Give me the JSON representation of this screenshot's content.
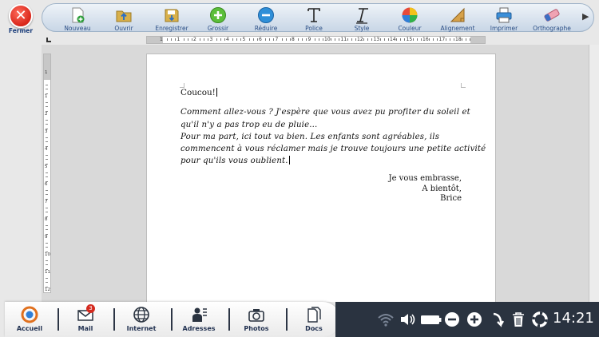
{
  "window": {
    "close_label": "Fermer",
    "close_glyph": "✕"
  },
  "toolbar": {
    "items": [
      {
        "label": "Nouveau",
        "icon": "new-document-icon"
      },
      {
        "label": "Ouvrir",
        "icon": "open-folder-icon"
      },
      {
        "label": "Enregistrer",
        "icon": "save-icon"
      },
      {
        "label": "Grossir",
        "icon": "zoom-in-icon"
      },
      {
        "label": "Réduire",
        "icon": "zoom-out-icon"
      },
      {
        "label": "Police",
        "icon": "font-icon"
      },
      {
        "label": "Style",
        "icon": "style-icon"
      },
      {
        "label": "Couleur",
        "icon": "color-icon"
      },
      {
        "label": "Alignement",
        "icon": "alignment-icon"
      },
      {
        "label": "Imprimer",
        "icon": "print-icon"
      },
      {
        "label": "Orthographe",
        "icon": "spellcheck-icon"
      }
    ],
    "more_glyph": "▶"
  },
  "ruler": {
    "h_numbers": [
      "1",
      "1",
      "2",
      "3",
      "4",
      "5",
      "6",
      "7",
      "8",
      "9",
      "10",
      "11",
      "12",
      "13",
      "14",
      "15",
      "16",
      "17",
      "18"
    ],
    "v_numbers": [
      "1",
      "1",
      "2",
      "3",
      "4",
      "5",
      "6",
      "7",
      "8",
      "9",
      "10",
      "11",
      "12"
    ]
  },
  "document": {
    "title": "Coucou!",
    "body_lines": [
      "Comment allez-vous ? J'espère que vous avez pu profiter du soleil et",
      "qu'il n'y a pas trop eu de pluie...",
      "Pour ma part, ici tout va bien. Les enfants sont agréables, ils",
      "commencent à vous réclamer mais je trouve toujours une petite activité",
      "pour qu'ils vous oublient."
    ],
    "signature_lines": [
      "Je vous embrasse,",
      "A bientôt,",
      "Brice"
    ]
  },
  "dock": {
    "items": [
      {
        "label": "Accueil",
        "icon": "home-icon"
      },
      {
        "label": "Mail",
        "icon": "mail-icon",
        "badge": "3"
      },
      {
        "label": "Internet",
        "icon": "globe-icon"
      },
      {
        "label": "Adresses",
        "icon": "contacts-icon"
      },
      {
        "label": "Photos",
        "icon": "camera-icon"
      },
      {
        "label": "Docs",
        "icon": "documents-icon"
      }
    ]
  },
  "status": {
    "time": "14:21",
    "icons": [
      "wifi-icon",
      "volume-icon",
      "battery-icon",
      "volume-down-icon",
      "volume-up-icon",
      "back-icon",
      "trash-icon",
      "help-icon"
    ]
  },
  "colors": {
    "toolbar_label": "#2b4f86",
    "close_red": "#d8261a",
    "status_bar": "#2a3340",
    "badge_red": "#d42a1f"
  }
}
